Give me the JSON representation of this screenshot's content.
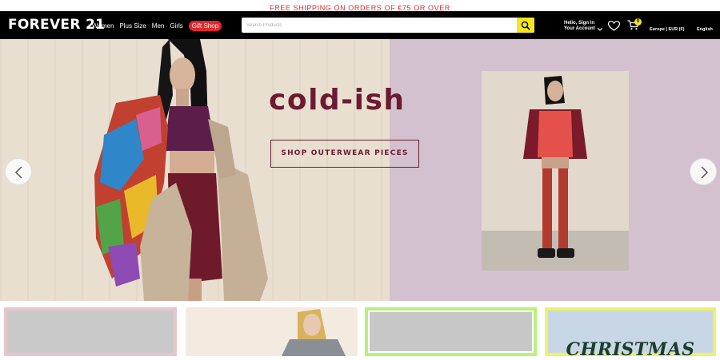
{
  "promo": {
    "text": "FREE SHIPPING ON ORDERS OF €75 OR OVER"
  },
  "header": {
    "logo": "FOREVER 21",
    "nav": [
      {
        "label": "Women"
      },
      {
        "label": "Plus Size"
      },
      {
        "label": "Men"
      },
      {
        "label": "Girls"
      }
    ],
    "gift_shop": "Gift Shop",
    "search_placeholder": "Search Products",
    "account_line1": "Hello, Sign in",
    "account_line2": "Your Account",
    "cart_count": "0",
    "region": "Europe | EUR (€)",
    "language": "English"
  },
  "hero": {
    "headline": "cold-ish",
    "cta": "SHOP OUTERWEAR PIECES"
  },
  "tiles": {
    "christmas": "CHRISTMAS"
  },
  "colors": {
    "promo_text": "#d9282f",
    "header_bg": "#000000",
    "search_button": "#f5e71f",
    "gift_shop_bg": "#e4262a",
    "hero_accent": "#6b1a31",
    "hero_right_bg": "#d4c1d0"
  },
  "icons": [
    "search-icon",
    "heart-icon",
    "cart-icon",
    "chevron-left-icon",
    "chevron-right-icon",
    "chevron-down-icon"
  ]
}
